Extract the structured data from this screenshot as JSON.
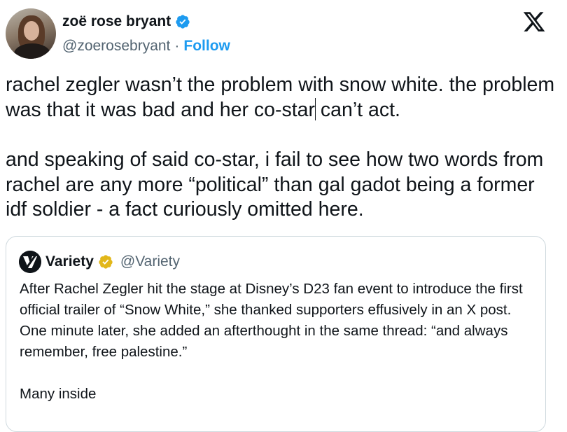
{
  "author": {
    "display_name": "zoë rose bryant",
    "handle": "@zoerosebryant",
    "separator": "·",
    "follow_label": "Follow"
  },
  "tweet": {
    "paragraph1_a": "rachel zegler wasn’t the problem with snow white. the problem was that it was bad and her co-star",
    "paragraph1_b": " can’t act.",
    "paragraph2": "and speaking of said co-star, i fail to see how two words from rachel are any more “political” than gal gadot being a former idf soldier - a fact curiously omitted here."
  },
  "quoted_tweet": {
    "display_name": "Variety",
    "handle": "@Variety",
    "paragraph1": "After Rachel Zegler hit the stage at Disney’s D23 fan event to introduce the first official trailer of “Snow White,” she thanked supporters effusively in an X post. One minute later, she added an afterthought in the same thread: “and always remember, free palestine.”",
    "paragraph2": "Many inside"
  },
  "icons": {
    "verified_blue": "verified-badge-icon",
    "verified_gold": "gold-verified-badge-icon",
    "platform": "x-logo-icon"
  },
  "colors": {
    "link_blue": "#1d9bf0",
    "secondary_text": "#536471",
    "gold_badge": "#e2b719",
    "border": "#cfd9de"
  }
}
